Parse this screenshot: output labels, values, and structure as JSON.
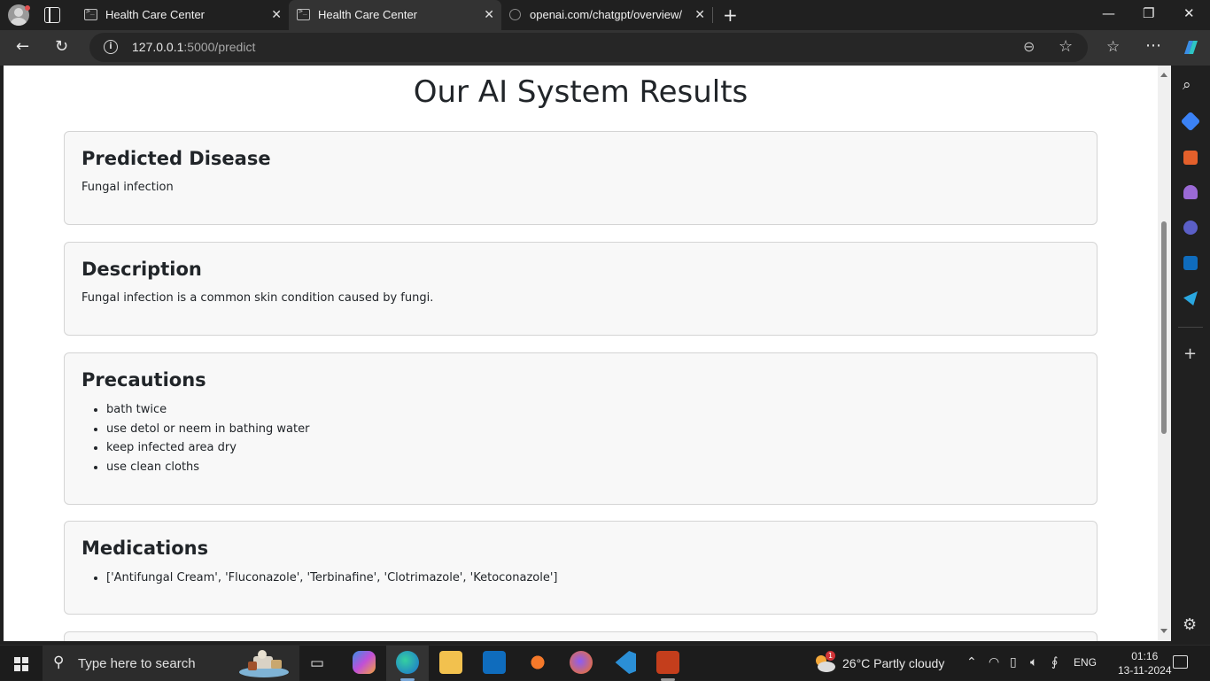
{
  "browser": {
    "tabs": [
      {
        "label": "Health Care Center",
        "icon": "terminal-icon",
        "active": false
      },
      {
        "label": "Health Care Center",
        "icon": "terminal-icon",
        "active": true
      },
      {
        "label": "openai.com/chatgpt/overview/",
        "icon": "globe-icon",
        "active": false
      }
    ],
    "address": {
      "host": "127.0.0.1",
      "path": ":5000/predict"
    }
  },
  "page": {
    "title": "Our AI System Results",
    "sections": {
      "disease": {
        "heading": "Predicted Disease",
        "text": "Fungal infection"
      },
      "description": {
        "heading": "Description",
        "text": "Fungal infection is a common skin condition caused by fungi."
      },
      "precautions": {
        "heading": "Precautions",
        "items": [
          "bath twice",
          "use detol or neem in bathing water",
          "keep infected area dry",
          "use clean cloths"
        ]
      },
      "medications": {
        "heading": "Medications",
        "items": [
          "['Antifungal Cream', 'Fluconazole', 'Terbinafine', 'Clotrimazole', 'Ketoconazole']"
        ]
      }
    }
  },
  "taskbar": {
    "search_placeholder": "Type here to search",
    "weather": "26°C  Partly cloudy",
    "weather_badge": "1",
    "language": "ENG",
    "time": "01:16",
    "date": "13-11-2024"
  },
  "colors": {
    "accent": "#0078d4",
    "page_bg": "#ffffff",
    "card_bg": "#f8f8f8",
    "chrome_bg": "#202020"
  }
}
